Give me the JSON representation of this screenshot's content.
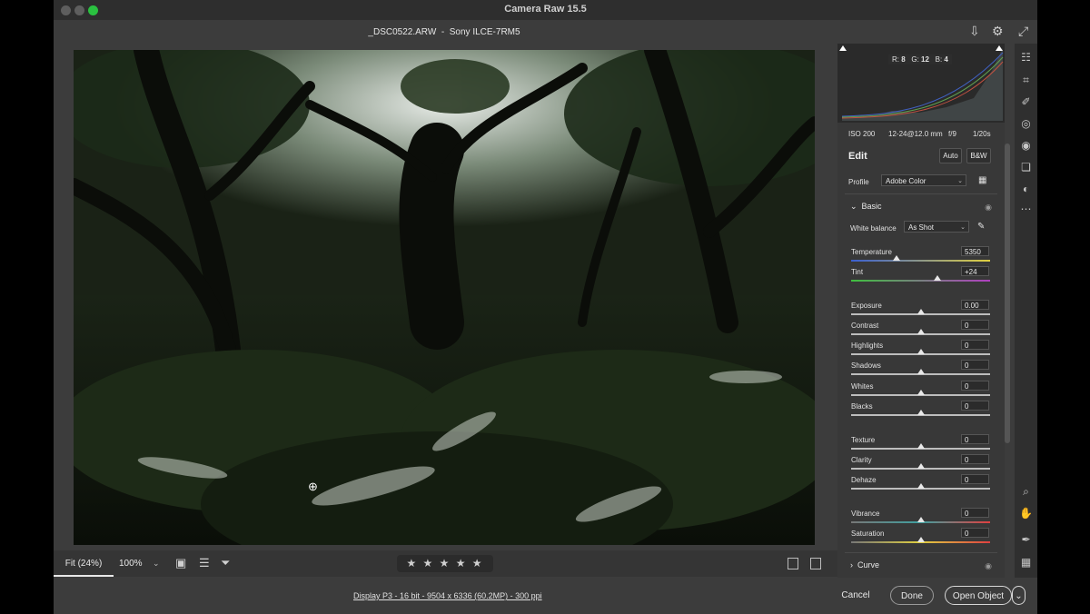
{
  "window": {
    "title": "Camera Raw 15.5"
  },
  "file": {
    "name": "_DSC0522.ARW",
    "separator": "-",
    "camera": "Sony ILCE-7RM5"
  },
  "histogram": {
    "r_label": "R:",
    "r": "8",
    "g_label": "G:",
    "g": "12",
    "b_label": "B:",
    "b": "4"
  },
  "exif": {
    "iso": "ISO 200",
    "focal": "12-24@12.0 mm",
    "aperture": "f/9",
    "shutter": "1/20s"
  },
  "edit": {
    "title": "Edit",
    "auto": "Auto",
    "bw": "B&W",
    "profile_label": "Profile",
    "profile_value": "Adobe Color"
  },
  "basic": {
    "title": "Basic",
    "wb_label": "White balance",
    "wb_value": "As Shot",
    "sliders": [
      {
        "name": "Temperature",
        "value": "5350",
        "pos": 0.33
      },
      {
        "name": "Tint",
        "value": "+24",
        "pos": 0.62
      },
      {
        "name": "Exposure",
        "value": "0.00",
        "pos": 0.5
      },
      {
        "name": "Contrast",
        "value": "0",
        "pos": 0.5
      },
      {
        "name": "Highlights",
        "value": "0",
        "pos": 0.5
      },
      {
        "name": "Shadows",
        "value": "0",
        "pos": 0.5
      },
      {
        "name": "Whites",
        "value": "0",
        "pos": 0.5
      },
      {
        "name": "Blacks",
        "value": "0",
        "pos": 0.5
      },
      {
        "name": "Texture",
        "value": "0",
        "pos": 0.5
      },
      {
        "name": "Clarity",
        "value": "0",
        "pos": 0.5
      },
      {
        "name": "Dehaze",
        "value": "0",
        "pos": 0.5
      },
      {
        "name": "Vibrance",
        "value": "0",
        "pos": 0.5
      },
      {
        "name": "Saturation",
        "value": "0",
        "pos": 0.5
      }
    ]
  },
  "curve": {
    "title": "Curve"
  },
  "bottom": {
    "fit": "Fit (24%)",
    "zoom": "100%",
    "stars": "★ ★ ★ ★ ★"
  },
  "footer": {
    "info": "Display P3 - 16 bit - 9504 x 6336 (60.2MP) - 300 ppi",
    "cancel": "Cancel",
    "done": "Done",
    "open": "Open Object"
  },
  "colors": {
    "accent_track_temp_left": "#3a5fd0",
    "accent_track_temp_right": "#e0d040",
    "tint_left": "#3fbf3f",
    "tint_right": "#b040c0"
  }
}
